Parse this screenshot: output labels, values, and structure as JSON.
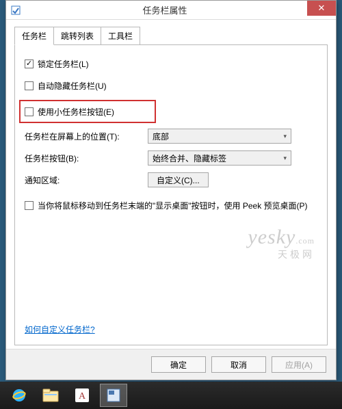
{
  "dialog": {
    "title": "任务栏属性",
    "close_glyph": "✕",
    "tabs": [
      {
        "label": "任务栏"
      },
      {
        "label": "跳转列表"
      },
      {
        "label": "工具栏"
      }
    ],
    "checkboxes": {
      "lock": {
        "label": "锁定任务栏(L)",
        "checked": true
      },
      "hide": {
        "label": "自动隐藏任务栏(U)",
        "checked": false
      },
      "small": {
        "label": "使用小任务栏按钮(E)",
        "checked": false
      },
      "peek": {
        "label": "当你将鼠标移动到任务栏末端的\"显示桌面\"按钮时，使用 Peek 预览桌面(P)",
        "checked": false
      }
    },
    "combos": {
      "position": {
        "label": "任务栏在屏幕上的位置(T):",
        "value": "底部"
      },
      "buttons": {
        "label": "任务栏按钮(B):",
        "value": "始终合并、隐藏标签"
      }
    },
    "notify": {
      "label": "通知区域:",
      "button": "自定义(C)..."
    },
    "link": "如何自定义任务栏?",
    "buttons": {
      "ok": "确定",
      "cancel": "取消",
      "apply": "应用(A)"
    }
  },
  "watermark": {
    "brand": "yesky",
    "suffix": ".com",
    "sub": "天极网"
  },
  "colors": {
    "close_bg": "#c75050",
    "highlight": "#d03030",
    "link": "#0066cc"
  }
}
